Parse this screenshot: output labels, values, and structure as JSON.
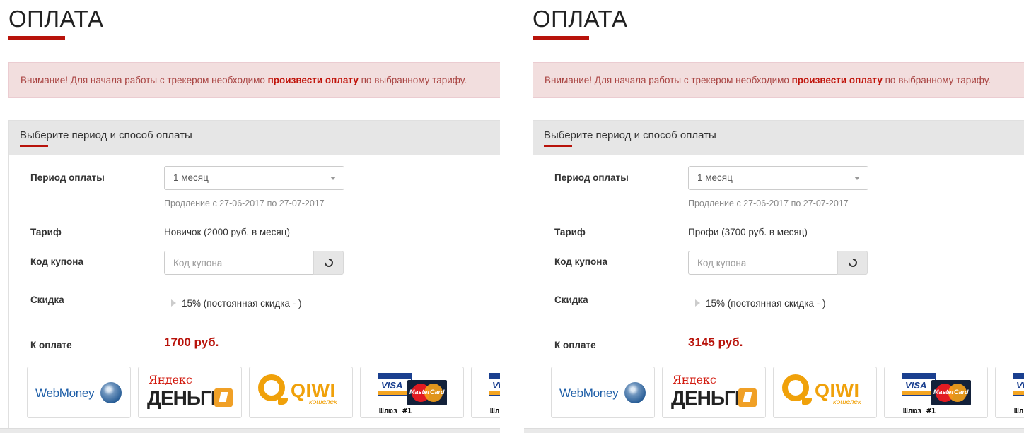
{
  "colors": {
    "accent": "#b8130b",
    "alert_bg": "#f2dede",
    "alert_text": "#a94442"
  },
  "panels": [
    {
      "page_title": "ОПЛАТА",
      "alert": {
        "before": "Внимание! Для начала работы с трекером необходимо ",
        "link": "произвести оплату",
        "after": " по выбранному тарифу."
      },
      "section_title": "Выберите период и способ оплаты",
      "fields": {
        "period_label": "Период оплаты",
        "period_value": "1 месяц",
        "renewal": "Продление с 27-06-2017 по 27-07-2017",
        "tariff_label": "Тариф",
        "tariff_value": "Новичок (2000 руб. в месяц)",
        "coupon_label": "Код купона",
        "coupon_placeholder": "Код купона",
        "discount_label": "Скидка",
        "discount_value": "15% (постоянная скидка - )",
        "amount_label": "К оплате",
        "amount_value": "1700 руб."
      },
      "payment_methods": {
        "webmoney": "WebMoney",
        "yandex_top": "Яндекс",
        "yandex_bottom": "ДЕНЬГИ",
        "qiwi": "QIWI",
        "qiwi_sub": "кошелек",
        "visa": "VISA",
        "mastercard": "MasterCard",
        "gateway1": "Шлюз #1",
        "gateway_partial": "Шл"
      }
    },
    {
      "page_title": "ОПЛАТА",
      "alert": {
        "before": "Внимание! Для начала работы с трекером необходимо ",
        "link": "произвести оплату",
        "after": " по выбранному тарифу."
      },
      "section_title": "Выберите период и способ оплаты",
      "fields": {
        "period_label": "Период оплаты",
        "period_value": "1 месяц",
        "renewal": "Продление с 27-06-2017 по 27-07-2017",
        "tariff_label": "Тариф",
        "tariff_value": "Профи (3700 руб. в месяц)",
        "coupon_label": "Код купона",
        "coupon_placeholder": "Код купона",
        "discount_label": "Скидка",
        "discount_value": "15% (постоянная скидка - )",
        "amount_label": "К оплате",
        "amount_value": "3145 руб."
      },
      "payment_methods": {
        "webmoney": "WebMoney",
        "yandex_top": "Яндекс",
        "yandex_bottom": "ДЕНЬГИ",
        "qiwi": "QIWI",
        "qiwi_sub": "кошелек",
        "visa": "VISA",
        "mastercard": "MasterCard",
        "gateway1": "Шлюз #1",
        "gateway_partial": "Шл"
      }
    }
  ]
}
